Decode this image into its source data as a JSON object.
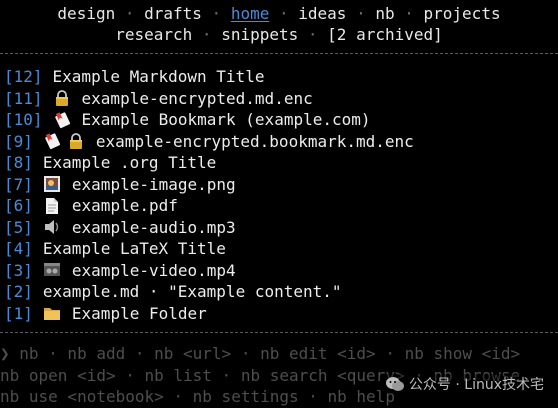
{
  "nav": {
    "line1": [
      "design",
      "drafts",
      "home",
      "ideas",
      "nb",
      "projects"
    ],
    "line2": [
      "research",
      "snippets",
      "[2 archived]"
    ],
    "active": "home",
    "separator": "·"
  },
  "items": [
    {
      "id": "[12]",
      "icons": [],
      "title": "Example Markdown Title"
    },
    {
      "id": "[11]",
      "icons": [
        "lock-icon"
      ],
      "title": "example-encrypted.md.enc"
    },
    {
      "id": "[10]",
      "icons": [
        "bookmark-icon"
      ],
      "title": "Example Bookmark (example.com)"
    },
    {
      "id": "[9]",
      "icons": [
        "bookmark-icon",
        "lock-icon"
      ],
      "title": "example-encrypted.bookmark.md.enc"
    },
    {
      "id": "[8]",
      "icons": [],
      "title": "Example .org Title"
    },
    {
      "id": "[7]",
      "icons": [
        "image-icon"
      ],
      "title": "example-image.png"
    },
    {
      "id": "[6]",
      "icons": [
        "document-icon"
      ],
      "title": "example.pdf"
    },
    {
      "id": "[5]",
      "icons": [
        "speaker-icon"
      ],
      "title": "example-audio.mp3"
    },
    {
      "id": "[4]",
      "icons": [],
      "title": "Example LaTeX Title"
    },
    {
      "id": "[3]",
      "icons": [
        "film-icon"
      ],
      "title": "example-video.mp4"
    },
    {
      "id": "[2]",
      "icons": [],
      "title": "example.md · \"Example content.\""
    },
    {
      "id": "[1]",
      "icons": [
        "folder-icon"
      ],
      "title": "Example Folder"
    }
  ],
  "help": {
    "line1": "❯ nb · nb add · nb <url> · nb edit <id> · nb show <id>",
    "line2": "nb open <id> · nb list · nb search <query> · nb browse",
    "line3": "nb use <notebook> · nb settings · nb help"
  },
  "watermark": {
    "text": "公众号 · Linux技术宅"
  },
  "colors": {
    "background": "#000000",
    "text": "#e8e8e8",
    "accent": "#4b8ad6",
    "muted": "#4e4e4e",
    "rule": "#5a5a5a"
  }
}
